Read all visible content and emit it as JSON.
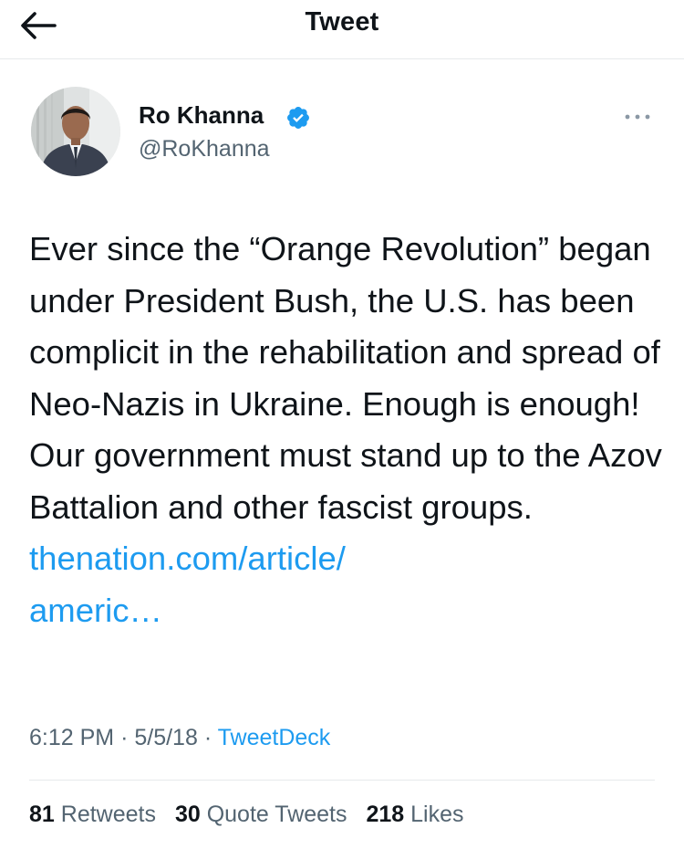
{
  "header": {
    "title": "Tweet",
    "back_icon": "arrow-left-icon"
  },
  "author": {
    "name": "Ro Khanna",
    "handle": "@RoKhanna",
    "verified_icon": "verified-badge-icon",
    "verified_color": "#1d9bf0"
  },
  "menu": {
    "icon": "more-options-icon"
  },
  "tweet": {
    "text": "Ever since the “Orange Revolution” began under President Bush, the U.S. has been complicit in the rehabilitation and spread of Neo-Nazis in Ukraine. Enough is enough! Our government must stand up to the Azov Battalion and other fascist groups.",
    "link_line1": "thenation.com/article/",
    "link_line2": "americ…",
    "link_color": "#1d9bf0"
  },
  "meta": {
    "time": "6:12 PM",
    "date": "5/5/18",
    "separator": "·",
    "source": "TweetDeck"
  },
  "stats": {
    "retweets_count": "81",
    "retweets_label": "Retweets",
    "quotes_count": "30",
    "quotes_label": "Quote Tweets",
    "likes_count": "218",
    "likes_label": "Likes"
  }
}
